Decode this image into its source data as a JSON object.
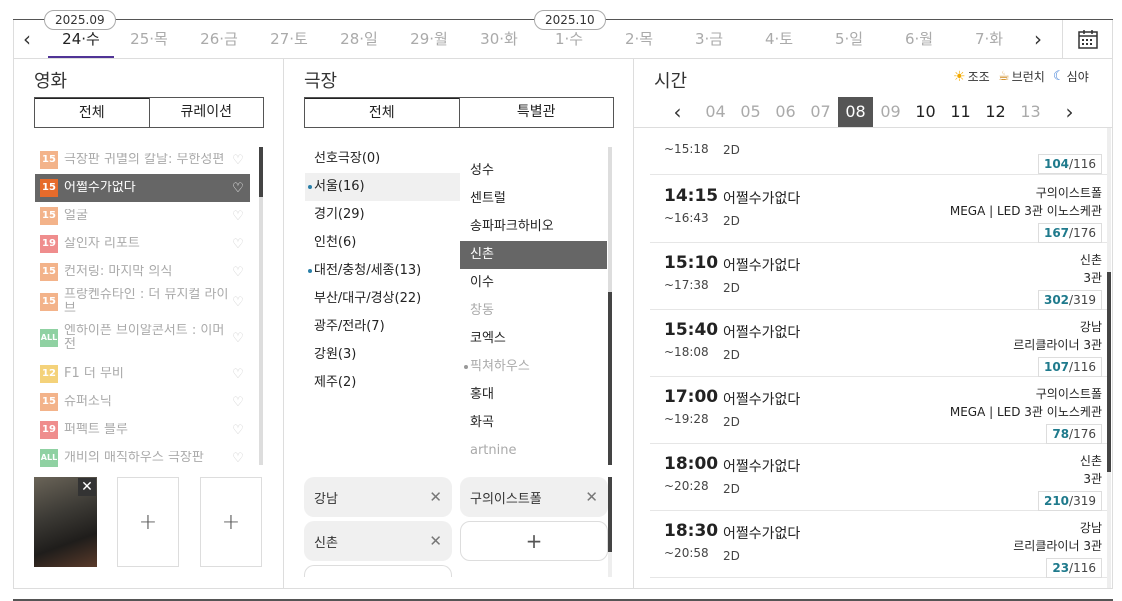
{
  "dates": {
    "month_labels": [
      "2025.09",
      "2025.10"
    ],
    "days": [
      "24·수",
      "25·목",
      "26·금",
      "27·토",
      "28·일",
      "29·월",
      "30·화",
      "1·수",
      "2·목",
      "3·금",
      "4·토",
      "5·일",
      "6·월",
      "7·화"
    ],
    "selected_index": 0,
    "prev_icon": "chevron-left-icon",
    "next_icon": "chevron-right-icon",
    "calendar_icon": "calendar-icon"
  },
  "movie": {
    "title": "영화",
    "tabs": [
      "전체",
      "큐레이션"
    ],
    "items": [
      {
        "age": "15",
        "name": "극장판 귀멸의 칼날: 무한성편"
      },
      {
        "age": "15",
        "name": "어쩔수가없다"
      },
      {
        "age": "15",
        "name": "얼굴"
      },
      {
        "age": "19",
        "name": "살인자 리포트"
      },
      {
        "age": "15",
        "name": "컨저링: 마지막 의식"
      },
      {
        "age": "15",
        "name": "프랑켄슈타인 : 더 뮤지컬 라이브"
      },
      {
        "age": "ALL",
        "name": "엔하이픈 브이알콘서트 : 이머전"
      },
      {
        "age": "12",
        "name": "F1 더 무비"
      },
      {
        "age": "15",
        "name": "슈퍼소닉"
      },
      {
        "age": "19",
        "name": "퍼펙트 블루"
      },
      {
        "age": "ALL",
        "name": "개비의 매직하우스 극장판"
      }
    ],
    "selected_index": 1,
    "add_slot": "+"
  },
  "theater": {
    "title": "극장",
    "tabs": [
      "전체",
      "특별관"
    ],
    "regions": [
      "선호극장(0)",
      "서울(16)",
      "경기(29)",
      "인천(6)",
      "대전/충청/세종(13)",
      "부산/대구/경상(22)",
      "광주/전라(7)",
      "강원(3)",
      "제주(2)"
    ],
    "selected_region": 1,
    "theaters": [
      "성수",
      "센트럴",
      "송파파크하비오",
      "신촌",
      "이수",
      "창동",
      "코엑스",
      "픽쳐하우스",
      "홍대",
      "화곡",
      "artnine"
    ],
    "selected_theater": 3,
    "chips": [
      "강남",
      "구의이스트폴",
      "신촌"
    ],
    "chip_add": "+"
  },
  "time": {
    "title": "시간",
    "legend": [
      "조조",
      "브런치",
      "심야"
    ],
    "hours": [
      "04",
      "05",
      "06",
      "07",
      "08",
      "09",
      "10",
      "11",
      "12",
      "13"
    ],
    "selected_hour": "08",
    "first_partial": {
      "end": "~15:18",
      "format": "2D",
      "seats_left": "104",
      "seats_total": "/116"
    },
    "shows": [
      {
        "start": "14:15",
        "end": "~16:43",
        "movie": "어쩔수가없다",
        "format": "2D",
        "hall1": "구의이스트폴",
        "hall2": "MEGA | LED 3관 이노스케관",
        "seats_left": "167",
        "seats_total": "/176"
      },
      {
        "start": "15:10",
        "end": "~17:38",
        "movie": "어쩔수가없다",
        "format": "2D",
        "hall1": "신촌",
        "hall2": "3관",
        "seats_left": "302",
        "seats_total": "/319"
      },
      {
        "start": "15:40",
        "end": "~18:08",
        "movie": "어쩔수가없다",
        "format": "2D",
        "hall1": "강남",
        "hall2": "르리클라이너 3관",
        "seats_left": "107",
        "seats_total": "/116"
      },
      {
        "start": "17:00",
        "end": "~19:28",
        "movie": "어쩔수가없다",
        "format": "2D",
        "hall1": "구의이스트폴",
        "hall2": "MEGA | LED 3관 이노스케관",
        "seats_left": "78",
        "seats_total": "/176"
      },
      {
        "start": "18:00",
        "end": "~20:28",
        "movie": "어쩔수가없다",
        "format": "2D",
        "hall1": "신촌",
        "hall2": "3관",
        "seats_left": "210",
        "seats_total": "/319"
      },
      {
        "start": "18:30",
        "end": "~20:58",
        "movie": "어쩔수가없다",
        "format": "2D",
        "hall1": "강남",
        "hall2": "르리클라이너 3관",
        "seats_left": "23",
        "seats_total": "/116"
      }
    ]
  }
}
